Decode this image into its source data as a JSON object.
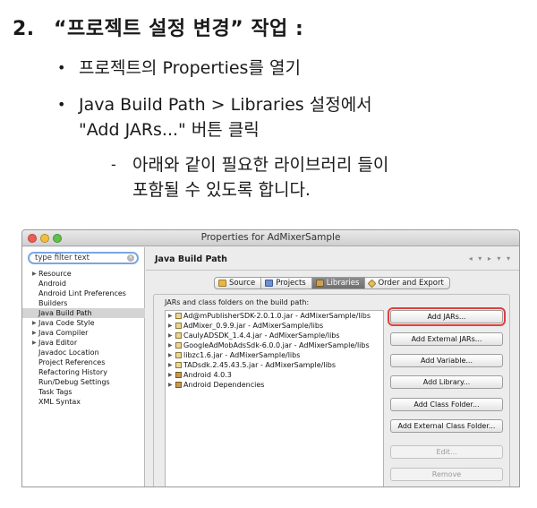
{
  "heading": {
    "number": "2.",
    "text": "“프로젝트 설정 변경” 작업 :"
  },
  "bullets": [
    {
      "marker": "•",
      "lines": [
        "프로젝트의 Properties를 열기"
      ]
    },
    {
      "marker": "•",
      "lines": [
        "Java Build Path > Libraries 설정에서",
        "\"Add JARs...\" 버튼 클릭"
      ]
    }
  ],
  "sub_bullet": {
    "marker": "-",
    "lines": [
      "아래와 같이 필요한 라이브러리 들이",
      "포함될 수 있도록 합니다."
    ]
  },
  "window": {
    "title": "Properties for AdMixerSample",
    "filter_placeholder": "type filter text",
    "tree": [
      {
        "label": "Resource",
        "expandable": true
      },
      {
        "label": "Android",
        "expandable": false
      },
      {
        "label": "Android Lint Preferences",
        "expandable": false
      },
      {
        "label": "Builders",
        "expandable": false
      },
      {
        "label": "Java Build Path",
        "expandable": false,
        "selected": true
      },
      {
        "label": "Java Code Style",
        "expandable": true
      },
      {
        "label": "Java Compiler",
        "expandable": true
      },
      {
        "label": "Java Editor",
        "expandable": true
      },
      {
        "label": "Javadoc Location",
        "expandable": false
      },
      {
        "label": "Project References",
        "expandable": false
      },
      {
        "label": "Refactoring History",
        "expandable": false
      },
      {
        "label": "Run/Debug Settings",
        "expandable": false
      },
      {
        "label": "Task Tags",
        "expandable": false
      },
      {
        "label": "XML Syntax",
        "expandable": false
      }
    ],
    "page_title": "Java Build Path",
    "tabs": [
      {
        "label": "Source",
        "icon": "source-folder-icon",
        "active": false
      },
      {
        "label": "Projects",
        "icon": "projects-icon",
        "active": false
      },
      {
        "label": "Libraries",
        "icon": "libraries-icon",
        "active": true
      },
      {
        "label": "Order and Export",
        "icon": "order-export-icon",
        "active": false
      }
    ],
    "list_label": "JARs and class folders on the build path:",
    "libraries": [
      {
        "label": "Ad@mPublisherSDK-2.0.1.0.jar - AdMixerSample/libs",
        "kind": "jar"
      },
      {
        "label": "AdMixer_0.9.9.jar - AdMixerSample/libs",
        "kind": "jar"
      },
      {
        "label": "CaulyADSDK_1.4.4.jar - AdMixerSample/libs",
        "kind": "jar"
      },
      {
        "label": "GoogleAdMobAdsSdk-6.0.0.jar - AdMixerSample/libs",
        "kind": "jar"
      },
      {
        "label": "libzc1.6.jar - AdMixerSample/libs",
        "kind": "jar"
      },
      {
        "label": "TADsdk.2.45.43.5.jar - AdMixerSample/libs",
        "kind": "jar"
      },
      {
        "label": "Android 4.0.3",
        "kind": "folder"
      },
      {
        "label": "Android Dependencies",
        "kind": "folder"
      }
    ],
    "buttons": [
      {
        "label": "Add JARs...",
        "enabled": true,
        "highlighted": true
      },
      {
        "label": "Add External JARs...",
        "enabled": true
      },
      {
        "label": "Add Variable...",
        "enabled": true
      },
      {
        "label": "Add Library...",
        "enabled": true
      },
      {
        "label": "Add Class Folder...",
        "enabled": true
      },
      {
        "label": "Add External Class Folder...",
        "enabled": true
      },
      {
        "label": "Edit...",
        "enabled": false
      },
      {
        "label": "Remove",
        "enabled": false
      }
    ],
    "highlight_color": "#e04040",
    "selected_item_color": "#d4d4d4"
  }
}
